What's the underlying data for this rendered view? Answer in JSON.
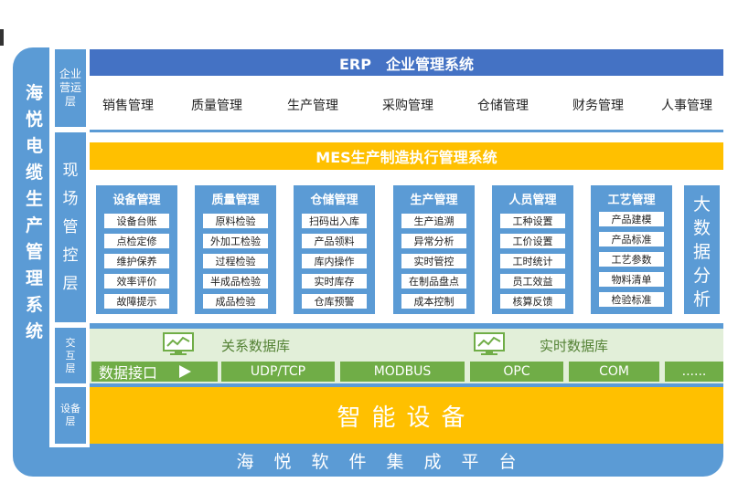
{
  "side_title": [
    "海",
    "悦",
    "电",
    "缆",
    "生",
    "产",
    "管",
    "理",
    "系",
    "统"
  ],
  "layers": {
    "erp": [
      "企业",
      "营运",
      "层"
    ],
    "field": [
      "现",
      "场",
      "管",
      "控",
      "层"
    ],
    "interaction": [
      "交",
      "互",
      "层"
    ],
    "device": [
      "设备",
      "层"
    ]
  },
  "erp": {
    "title": "ERP　企业管理系统",
    "items": [
      "销售管理",
      "质量管理",
      "生产管理",
      "采购管理",
      "仓储管理",
      "财务管理",
      "人事管理"
    ]
  },
  "mes": {
    "title": "MES生产制造执行管理系统",
    "modules": [
      {
        "title": "设备管理",
        "items": [
          "设备台账",
          "点检定修",
          "维护保养",
          "效率评价",
          "故障提示"
        ]
      },
      {
        "title": "质量管理",
        "items": [
          "原料检验",
          "外加工检验",
          "过程检验",
          "半成品检验",
          "成品检验"
        ]
      },
      {
        "title": "仓储管理",
        "items": [
          "扫码出入库",
          "产品领料",
          "库内操作",
          "实时库存",
          "仓库预警"
        ]
      },
      {
        "title": "生产管理",
        "items": [
          "生产追溯",
          "异常分析",
          "实时管控",
          "在制品盘点",
          "成本控制"
        ]
      },
      {
        "title": "人员管理",
        "items": [
          "工种设置",
          "工价设置",
          "工时统计",
          "员工效益",
          "核算反馈"
        ]
      },
      {
        "title": "工艺管理",
        "items": [
          "产品建模",
          "产品标准",
          "工艺参数",
          "物料清单",
          "检验标准"
        ]
      }
    ],
    "bigdata": [
      "大",
      "数",
      "据",
      "分",
      "析"
    ]
  },
  "interaction": {
    "db1": "关系数据库",
    "db2": "实时数据库",
    "interface_label": "数据接口",
    "protocols": [
      "UDP/TCP",
      "MODBUS",
      "OPC",
      "COM",
      "......"
    ]
  },
  "device_title": "智能设备",
  "platform_title": "海悦软件集成平台",
  "colors": {
    "blue": "#5b9bd5",
    "dark_blue": "#4472c4",
    "yellow": "#ffc000",
    "green": "#70ad47",
    "light_green": "#e2efd9"
  }
}
